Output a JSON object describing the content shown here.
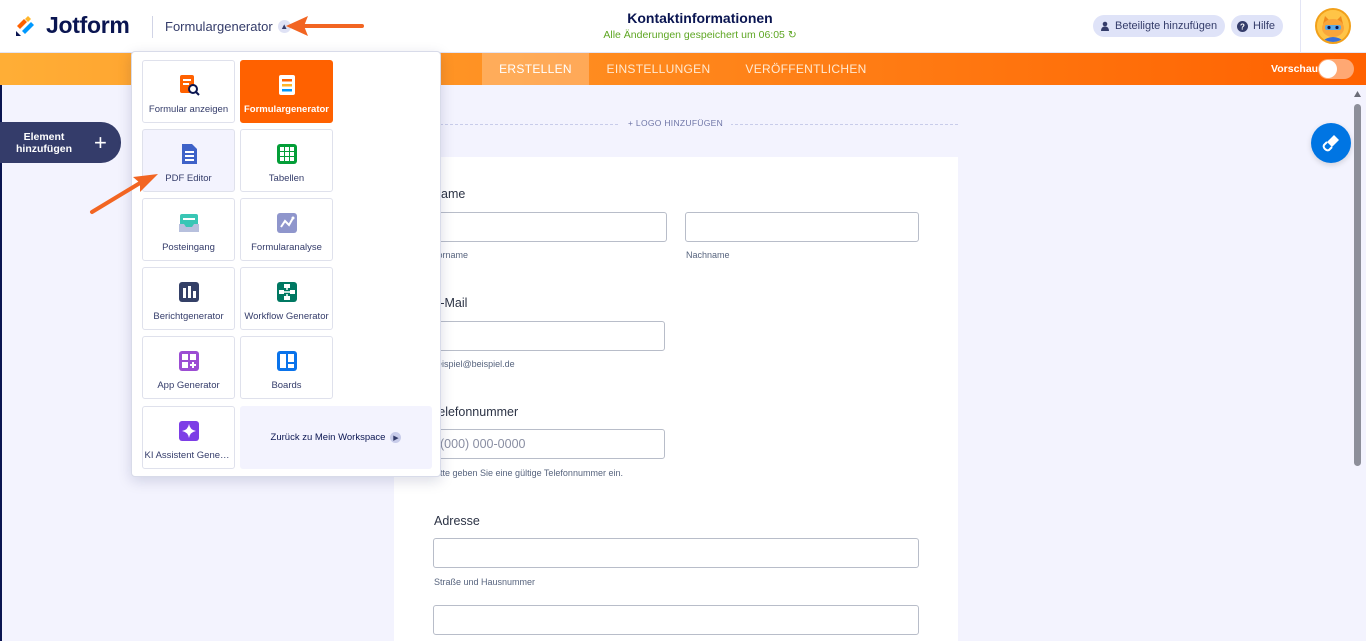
{
  "header": {
    "brand": "Jotform",
    "app_switcher": "Formulargenerator",
    "form_title": "Kontaktinformationen",
    "save_status": "Alle Änderungen gespeichert um 06:05",
    "invite_button": "Beteiligte hinzufügen",
    "help_button": "Hilfe"
  },
  "nav": {
    "tabs": [
      {
        "label": "ERSTELLEN",
        "active": true
      },
      {
        "label": "EINSTELLUNGEN",
        "active": false
      },
      {
        "label": "VERÖFFENTLICHEN",
        "active": false
      }
    ],
    "preview_label": "Vorschau",
    "preview_enabled": false
  },
  "sidebar": {
    "add_element_line1": "Element",
    "add_element_line2": "hinzufügen"
  },
  "dropdown": {
    "items": [
      {
        "label": "Formular anzeigen",
        "icon": "form-view-icon",
        "active": false
      },
      {
        "label": "Formulargenerator",
        "icon": "form-builder-icon",
        "active": true
      },
      {
        "label": "PDF Editor",
        "icon": "pdf-editor-icon",
        "active": false
      },
      {
        "label": "Tabellen",
        "icon": "tables-icon",
        "active": false
      },
      {
        "label": "Posteingang",
        "icon": "inbox-icon",
        "active": false
      },
      {
        "label": "Formularanalyse",
        "icon": "analytics-icon",
        "active": false
      },
      {
        "label": "Berichtgenerator",
        "icon": "report-icon",
        "active": false
      },
      {
        "label": "Workflow Generator",
        "icon": "workflow-icon",
        "active": false
      },
      {
        "label": "App Generator",
        "icon": "app-icon",
        "active": false
      },
      {
        "label": "Boards",
        "icon": "boards-icon",
        "active": false
      },
      {
        "label": "KI Assistent Generator",
        "icon": "ai-agent-icon",
        "active": false
      }
    ],
    "back_to_workspace": "Zurück zu Mein Workspace"
  },
  "form": {
    "logo_add": "+ LOGO HINZUFÜGEN",
    "name_label": "Name",
    "first_name_sub": "Vorname",
    "last_name_sub": "Nachname",
    "email_label": "E-Mail",
    "email_sub": "beispiel@beispiel.de",
    "phone_label": "Telefonnummer",
    "phone_placeholder": "(000) 000-0000",
    "phone_sub": "Bitte geben Sie eine gültige Telefonnummer ein.",
    "address_label": "Adresse",
    "street_sub": "Straße und Hausnummer"
  },
  "colors": {
    "brand_orange": "#ff6100",
    "navy": "#0a1551",
    "saved_green": "#5ea623",
    "accent_blue": "#0075e3",
    "annotation_arrow": "#f26522"
  }
}
